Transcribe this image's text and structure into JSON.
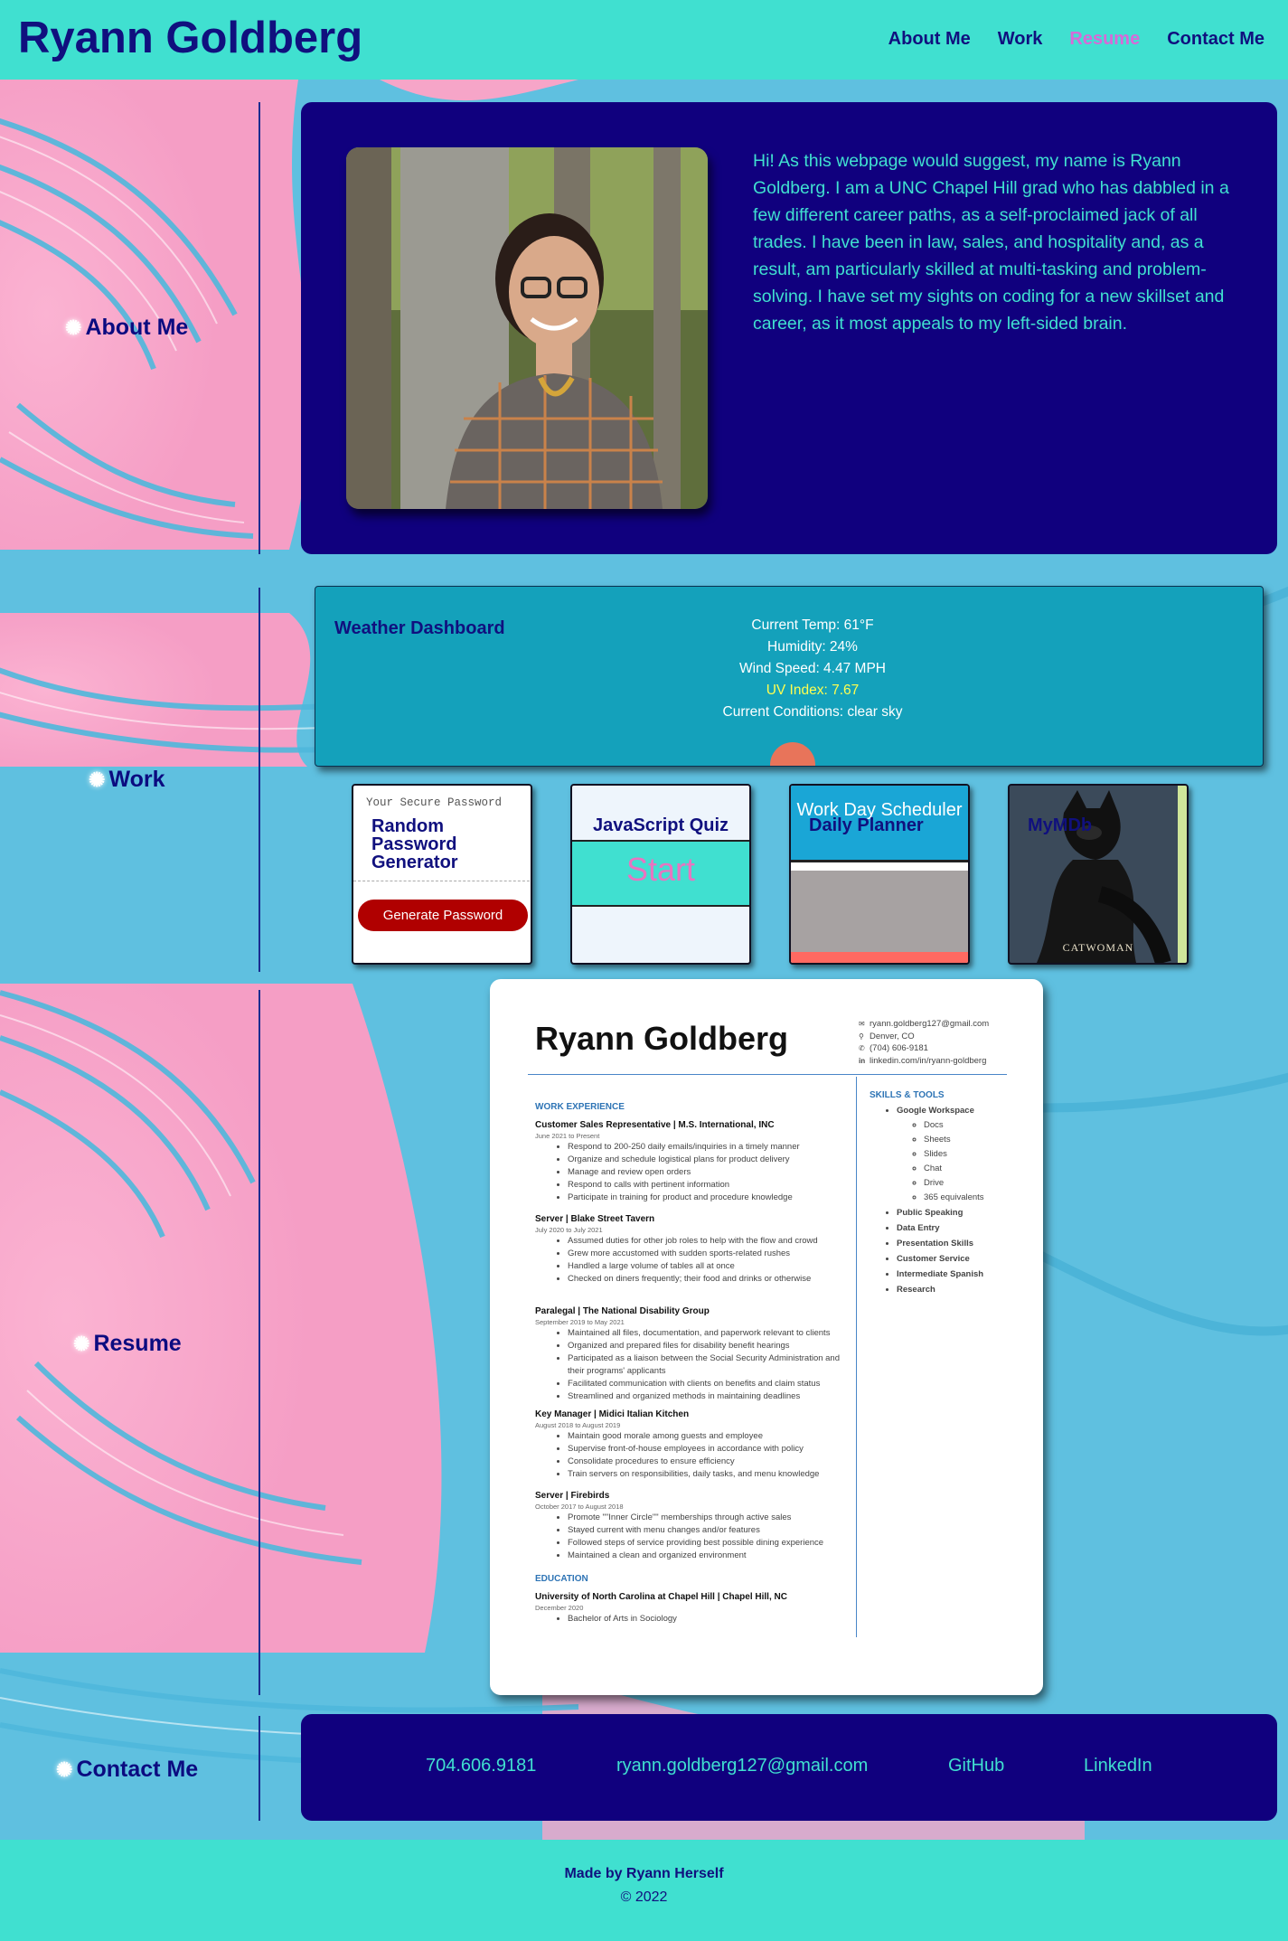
{
  "header": {
    "title": "Ryann Goldberg",
    "nav": [
      "About Me",
      "Work",
      "Resume",
      "Contact Me"
    ]
  },
  "about": {
    "label": "About Me",
    "bio": "Hi! As this webpage would suggest, my name is Ryann Goldberg. I am a UNC Chapel Hill grad who has dabbled in a few different career paths, as a self-proclaimed jack of all trades. I have been in law, sales, and hospitality and, as a result, am particularly skilled at multi-tasking and problem-solving. I have set my sights on coding for a new skillset and career, as it most appeals to my left-sided brain."
  },
  "work": {
    "label": "Work",
    "weather": {
      "title": "Weather Dashboard",
      "temp": "Current Temp: 61°F",
      "humidity": "Humidity: 24%",
      "wind": "Wind Speed: 4.47 MPH",
      "uv": "UV Index: 7.67",
      "conditions": "Current Conditions: clear sky"
    },
    "password": {
      "title": "Random Password Generator",
      "placeholder": "Your Secure Password",
      "button": "Generate Password"
    },
    "quiz": {
      "title": "JavaScript Quiz",
      "start": "Start"
    },
    "planner": {
      "title": "Daily Planner",
      "header": "Work Day Scheduler"
    },
    "mymdb": {
      "title": "MyMDb",
      "poster": "CATWOMAN"
    }
  },
  "resume": {
    "label": "Resume",
    "name": "Ryann Goldberg",
    "contact": [
      "ryann.goldberg127@gmail.com",
      "Denver, CO",
      "(704) 606-9181",
      "linkedin.com/in/ryann-goldberg"
    ],
    "work_heading": "WORK EXPERIENCE",
    "jobs": [
      {
        "title": "Customer Sales Representative | M.S. International, INC",
        "dates": "June 2021 to Present",
        "bullets": [
          "Respond to 200-250 daily emails/inquiries in a timely manner",
          "Organize and schedule logistical plans for product delivery",
          "Manage and review open orders",
          "Respond to calls with pertinent information",
          "Participate in training for product and procedure knowledge"
        ]
      },
      {
        "title": "Server | Blake Street Tavern",
        "dates": "July 2020 to July 2021",
        "bullets": [
          "Assumed duties for other job roles to help with the flow and crowd",
          "Grew more accustomed with sudden sports-related rushes",
          "Handled a large volume of tables all at once",
          "Checked on diners frequently; their food and drinks or otherwise"
        ]
      },
      {
        "title": "Paralegal | The National Disability Group",
        "dates": "September 2019 to May 2021",
        "bullets": [
          "Maintained all files, documentation, and paperwork relevant to clients",
          "Organized and prepared files for disability benefit hearings",
          "Participated as a liaison between the Social Security Administration and their programs' applicants",
          "Facilitated communication with clients on benefits and claim status",
          "Streamlined and organized methods in maintaining deadlines"
        ]
      },
      {
        "title": "Key Manager | Midici Italian Kitchen",
        "dates": "August 2018 to August 2019",
        "bullets": [
          "Maintain good morale among guests and employee",
          "Supervise front-of-house employees in accordance with policy",
          "Consolidate procedures to ensure efficiency",
          "Train servers on responsibilities, daily tasks, and menu knowledge"
        ]
      },
      {
        "title": "Server | Firebirds",
        "dates": "October 2017 to August 2018",
        "bullets": [
          "Promote \"\"Inner Circle\"\" memberships through active sales",
          "Stayed current with menu changes and/or features",
          "Followed steps of service providing best possible dining experience",
          "Maintained a clean and organized environment"
        ]
      }
    ],
    "education_heading": "EDUCATION",
    "education": {
      "title": "University of North Carolina at Chapel Hill | Chapel Hill, NC",
      "dates": "December 2020",
      "bullets": [
        "Bachelor of Arts in Sociology"
      ]
    },
    "skills_heading": "SKILLS & TOOLS",
    "workspace": "Google Workspace",
    "workspace_items": [
      "Docs",
      "Sheets",
      "Slides",
      "Chat",
      "Drive",
      "365 equivalents"
    ],
    "skills": [
      "Public Speaking",
      "Data Entry",
      "Presentation Skills",
      "Customer Service",
      "Intermediate Spanish",
      "Research"
    ]
  },
  "contact": {
    "label": "Contact Me",
    "phone": "704.606.9181",
    "email": "ryann.goldberg127@gmail.com",
    "github": "GitHub",
    "linkedin": "LinkedIn"
  },
  "footer": {
    "line1": "Made by Ryann Herself",
    "line2": "© 2022"
  },
  "colors": {
    "teal": "#40e0d0",
    "navy": "#10007e",
    "pink": "#f7aacb",
    "sky": "#5bbfe0",
    "weather": "#14a1bb",
    "button_red": "#b00000"
  }
}
